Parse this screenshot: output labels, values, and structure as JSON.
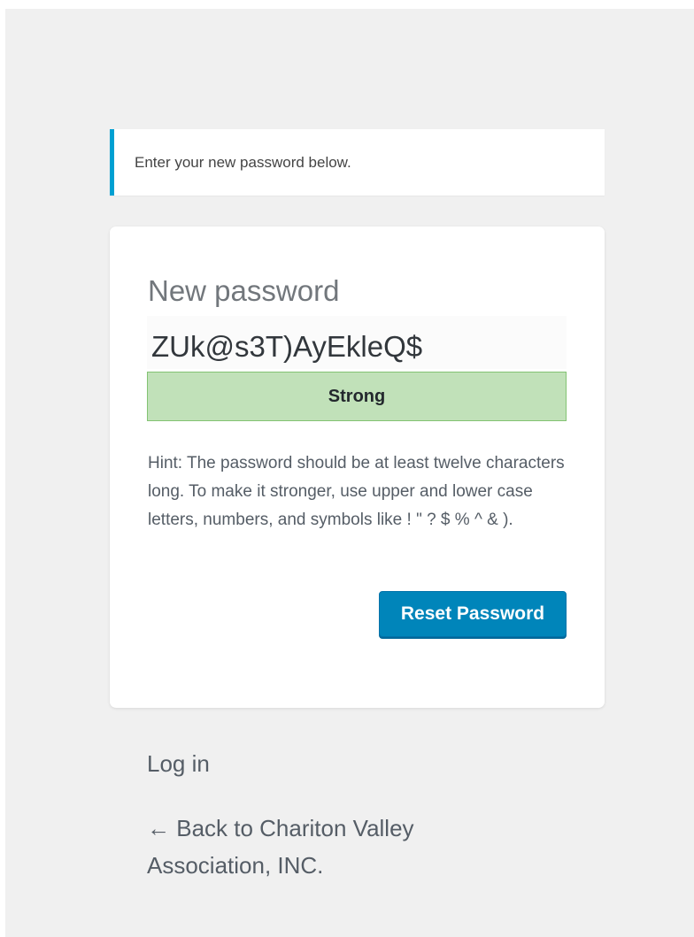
{
  "message": {
    "text": "Enter your new password below."
  },
  "form": {
    "password_label": "New password",
    "password_value": "ZUk@s3T)AyEkleQ$",
    "strength": "Strong",
    "hint": "Hint: The password should be at least twelve characters long. To make it stronger, use upper and lower case letters, numbers, and symbols like ! \" ? $ % ^ & ).",
    "submit_label": "Reset Password"
  },
  "nav": {
    "login_label": "Log in",
    "back_label": "← Back to Chariton Valley Association, INC."
  },
  "colors": {
    "accent": "#00a0d2",
    "button": "#0085ba",
    "strength_strong": "#c1e1b9",
    "background": "#f0f0f0"
  }
}
